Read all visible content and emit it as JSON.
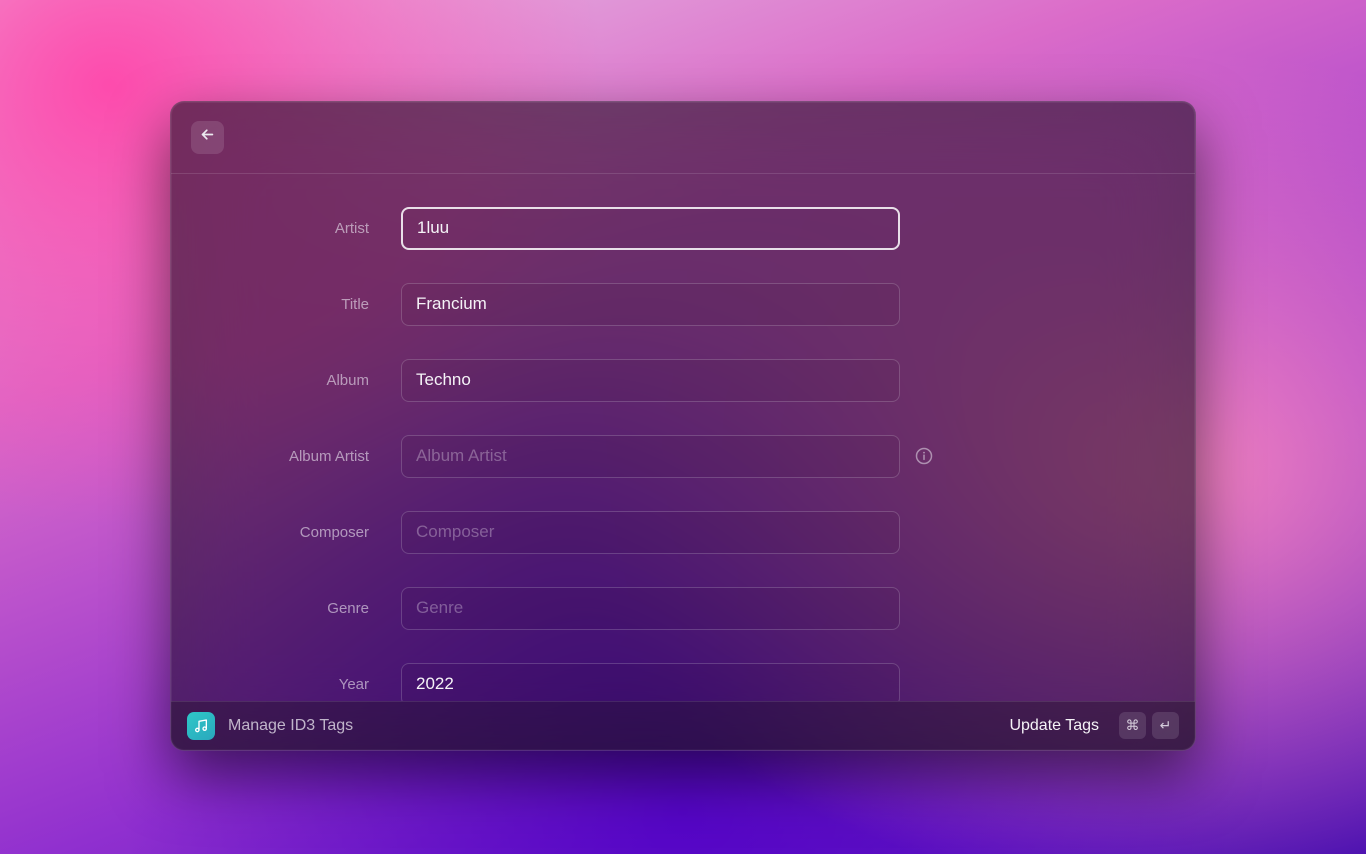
{
  "form": {
    "fields": [
      {
        "label": "Artist",
        "value": "1luu",
        "placeholder": "Artist",
        "focused": true,
        "info": false
      },
      {
        "label": "Title",
        "value": "Francium",
        "placeholder": "Title",
        "focused": false,
        "info": false
      },
      {
        "label": "Album",
        "value": "Techno",
        "placeholder": "Album",
        "focused": false,
        "info": false
      },
      {
        "label": "Album Artist",
        "value": "",
        "placeholder": "Album Artist",
        "focused": false,
        "info": true
      },
      {
        "label": "Composer",
        "value": "",
        "placeholder": "Composer",
        "focused": false,
        "info": false
      },
      {
        "label": "Genre",
        "value": "",
        "placeholder": "Genre",
        "focused": false,
        "info": false
      },
      {
        "label": "Year",
        "value": "2022",
        "placeholder": "Year",
        "focused": false,
        "info": false
      }
    ]
  },
  "footer": {
    "app_label": "Manage ID3 Tags",
    "action_label": "Update Tags",
    "shortcut_modifier": "⌘",
    "shortcut_key": "↵"
  }
}
